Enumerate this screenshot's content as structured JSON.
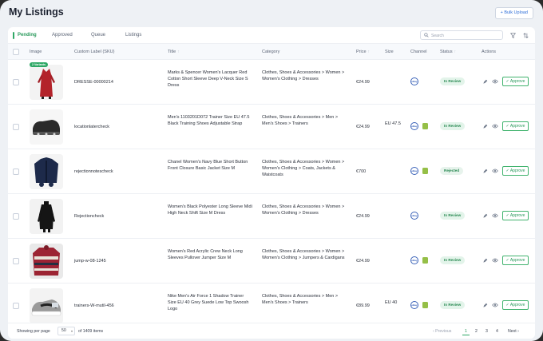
{
  "page": {
    "title": "My Listings",
    "bulk_upload": "+ Bulk Upload"
  },
  "tabs": [
    "Pending",
    "Approved",
    "Queue",
    "Listings"
  ],
  "search": {
    "placeholder": "Search"
  },
  "columns": {
    "image": "Image",
    "sku": "Custom Label (SKU)",
    "title": "Title",
    "category": "Category",
    "price": "Price",
    "size": "Size",
    "channel": "Channel",
    "status": "Status",
    "actions": "Actions"
  },
  "rows": [
    {
      "badge": "2 Variants",
      "sku": "DRESSE-00000214",
      "title": "Marks & Spencer Women's Lacquer Red Cotton Short Sleeve Deep V-Neck Size S Dress",
      "category": "Clothes, Shoes & Accessories > Women > Women's Clothing > Dresses",
      "price": "€24.99",
      "size": "",
      "shopify": false,
      "status": "In Review",
      "approve": "✓ Approve"
    },
    {
      "badge": "",
      "sku": "locationlatercheck",
      "title": "Men's 1103201D072 Trainer Size EU 47.5 Black Training Shoes Adjustable Strap",
      "category": "Clothes, Shoes & Accessories > Men > Men's Shoes > Trainers",
      "price": "€24.99",
      "size": "EU 47.5",
      "shopify": true,
      "status": "In Review",
      "approve": "✓ Approve"
    },
    {
      "badge": "",
      "sku": "rejectionnotescheck",
      "title": "Chanel Women's Navy Blue Short Button Front Closure Basic Jacket Size M",
      "category": "Clothes, Shoes & Accessories > Women > Women's Clothing > Coats, Jackets & Waistcoats",
      "price": "€700",
      "size": "",
      "shopify": true,
      "status": "Rejected",
      "approve": "✓ Approve"
    },
    {
      "badge": "",
      "sku": "Rejectioncheck",
      "title": "Women's Black Polyester Long Sleeve Midi High Neck Shift Size M Dress",
      "category": "Clothes, Shoes & Accessories > Women > Women's Clothing > Dresses",
      "price": "€24.99",
      "size": "",
      "shopify": false,
      "status": "In Review",
      "approve": "✓ Approve"
    },
    {
      "badge": "",
      "sku": "jump-w-08-1245",
      "title": "Women's Red Acrylic Crew Neck Long Sleeves Pullover Jumper Size M",
      "category": "Clothes, Shoes & Accessories > Women > Women's Clothing > Jumpers & Cardigans",
      "price": "€24.99",
      "size": "",
      "shopify": true,
      "status": "In Review",
      "approve": "✓ Approve"
    },
    {
      "badge": "",
      "sku": "trainers-W-mutil-456",
      "title": "Nike Men's Air Force 1 Shadow Trainer Size EU 40 Grey Suede Low Top Swoosh Logo",
      "category": "Clothes, Shoes & Accessories > Men > Men's Shoes > Trainers",
      "price": "€89.99",
      "size": "EU 40",
      "shopify": true,
      "status": "In Review",
      "approve": "✓ Approve"
    }
  ],
  "footer": {
    "showing": "Showing per page",
    "per_page": "50",
    "total": "of 1409 items",
    "previous": "‹ Previous",
    "pages": [
      "1",
      "2",
      "3",
      "4"
    ],
    "next": "Next ›"
  },
  "colors": {
    "accent": "#2fa866",
    "status_bg": "#e3f4ea",
    "channel_ring": "#3a62b8",
    "shopify": "#95bf47"
  }
}
